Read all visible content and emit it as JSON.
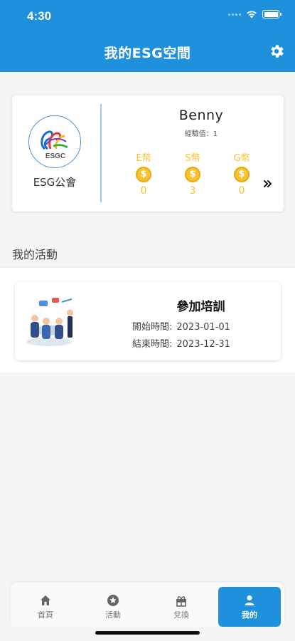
{
  "status_bar": {
    "time": "4:30"
  },
  "header": {
    "title": "我的ESG空間"
  },
  "profile": {
    "org_logo_text": "ESGC",
    "org_name": "ESG公會",
    "user_name": "Benny",
    "exp_label": "經驗值：1",
    "coins": [
      {
        "label": "E幣",
        "symbol": "$",
        "value": "0"
      },
      {
        "label": "S幣",
        "symbol": "$",
        "value": "3"
      },
      {
        "label": "G幣",
        "symbol": "$",
        "value": "0"
      }
    ]
  },
  "activities_section": {
    "title": "我的活動",
    "items": [
      {
        "title": "參加培訓",
        "start_label": "開始時間:",
        "start_date": "2023-01-01",
        "end_label": "結束時間:",
        "end_date": "2023-12-31"
      }
    ]
  },
  "bottom_nav": {
    "items": [
      {
        "label": "首頁",
        "icon": "home-icon"
      },
      {
        "label": "活動",
        "icon": "star-icon"
      },
      {
        "label": "兌換",
        "icon": "gift-icon"
      },
      {
        "label": "我的",
        "icon": "person-icon"
      }
    ],
    "active_index": 3
  },
  "colors": {
    "primary": "#1e90dc",
    "coin": "#f5c230",
    "background": "#f5f5f5"
  }
}
